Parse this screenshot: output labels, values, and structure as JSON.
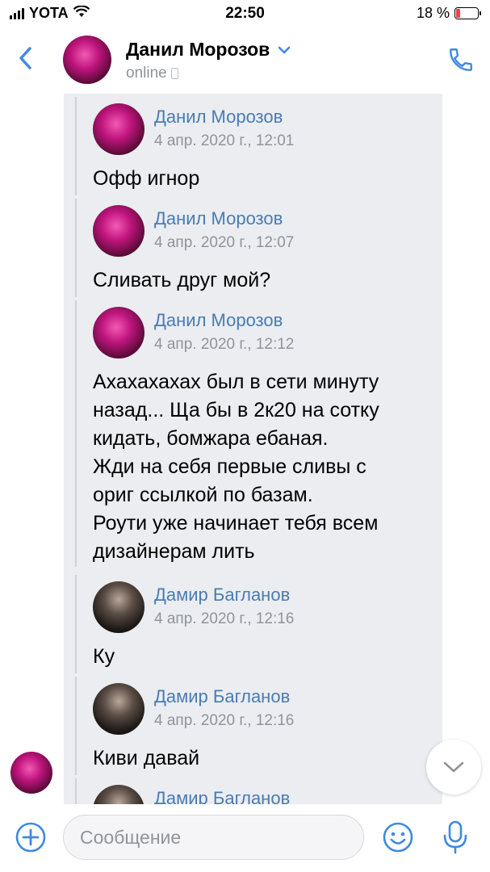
{
  "status_bar": {
    "carrier": "YOTA",
    "time": "22:50",
    "battery_percent": "18 %",
    "battery_level": 0.18
  },
  "header": {
    "name": "Данил Морозов",
    "status": "online",
    "icons": [
      "back-chevron-icon",
      "chevron-down-icon",
      "mobile-phone-icon",
      "phone-icon"
    ]
  },
  "forwarded_messages": [
    {
      "author": "Данил Морозов",
      "date": "4 апр. 2020 г., 12:01",
      "text": "Офф игнор",
      "avatar": "pink"
    },
    {
      "author": "Данил Морозов",
      "date": "4 апр. 2020 г., 12:07",
      "text": "Сливать друг мой?",
      "avatar": "pink"
    },
    {
      "author": "Данил Морозов",
      "date": "4 апр. 2020 г., 12:12",
      "text": "Ахахахахах был в сети минуту\nназад... Ща бы в 2к20 на сотку\nкидать, бомжара ебаная.\nЖди на себя первые сливы с\nориг ссылкой по базам.\nРоути уже начинает тебя всем\nдизайнерам лить",
      "avatar": "pink"
    },
    {
      "author": "Дамир Багланов",
      "date": "4 апр. 2020 г., 12:16",
      "text": "Ку",
      "avatar": "dark"
    },
    {
      "author": "Дамир Багланов",
      "date": "4 апр. 2020 г., 12:16",
      "text": "Киви давай",
      "avatar": "dark"
    },
    {
      "author": "Дамир Багланов",
      "date": "",
      "text": "",
      "avatar": "dark"
    }
  ],
  "composer": {
    "placeholder": "Сообщение",
    "value": ""
  },
  "colors": {
    "accent": "#4a7bb3",
    "icon_blue": "#3f8ae0",
    "forward_bg": "#ebedf0",
    "muted": "#909499"
  }
}
